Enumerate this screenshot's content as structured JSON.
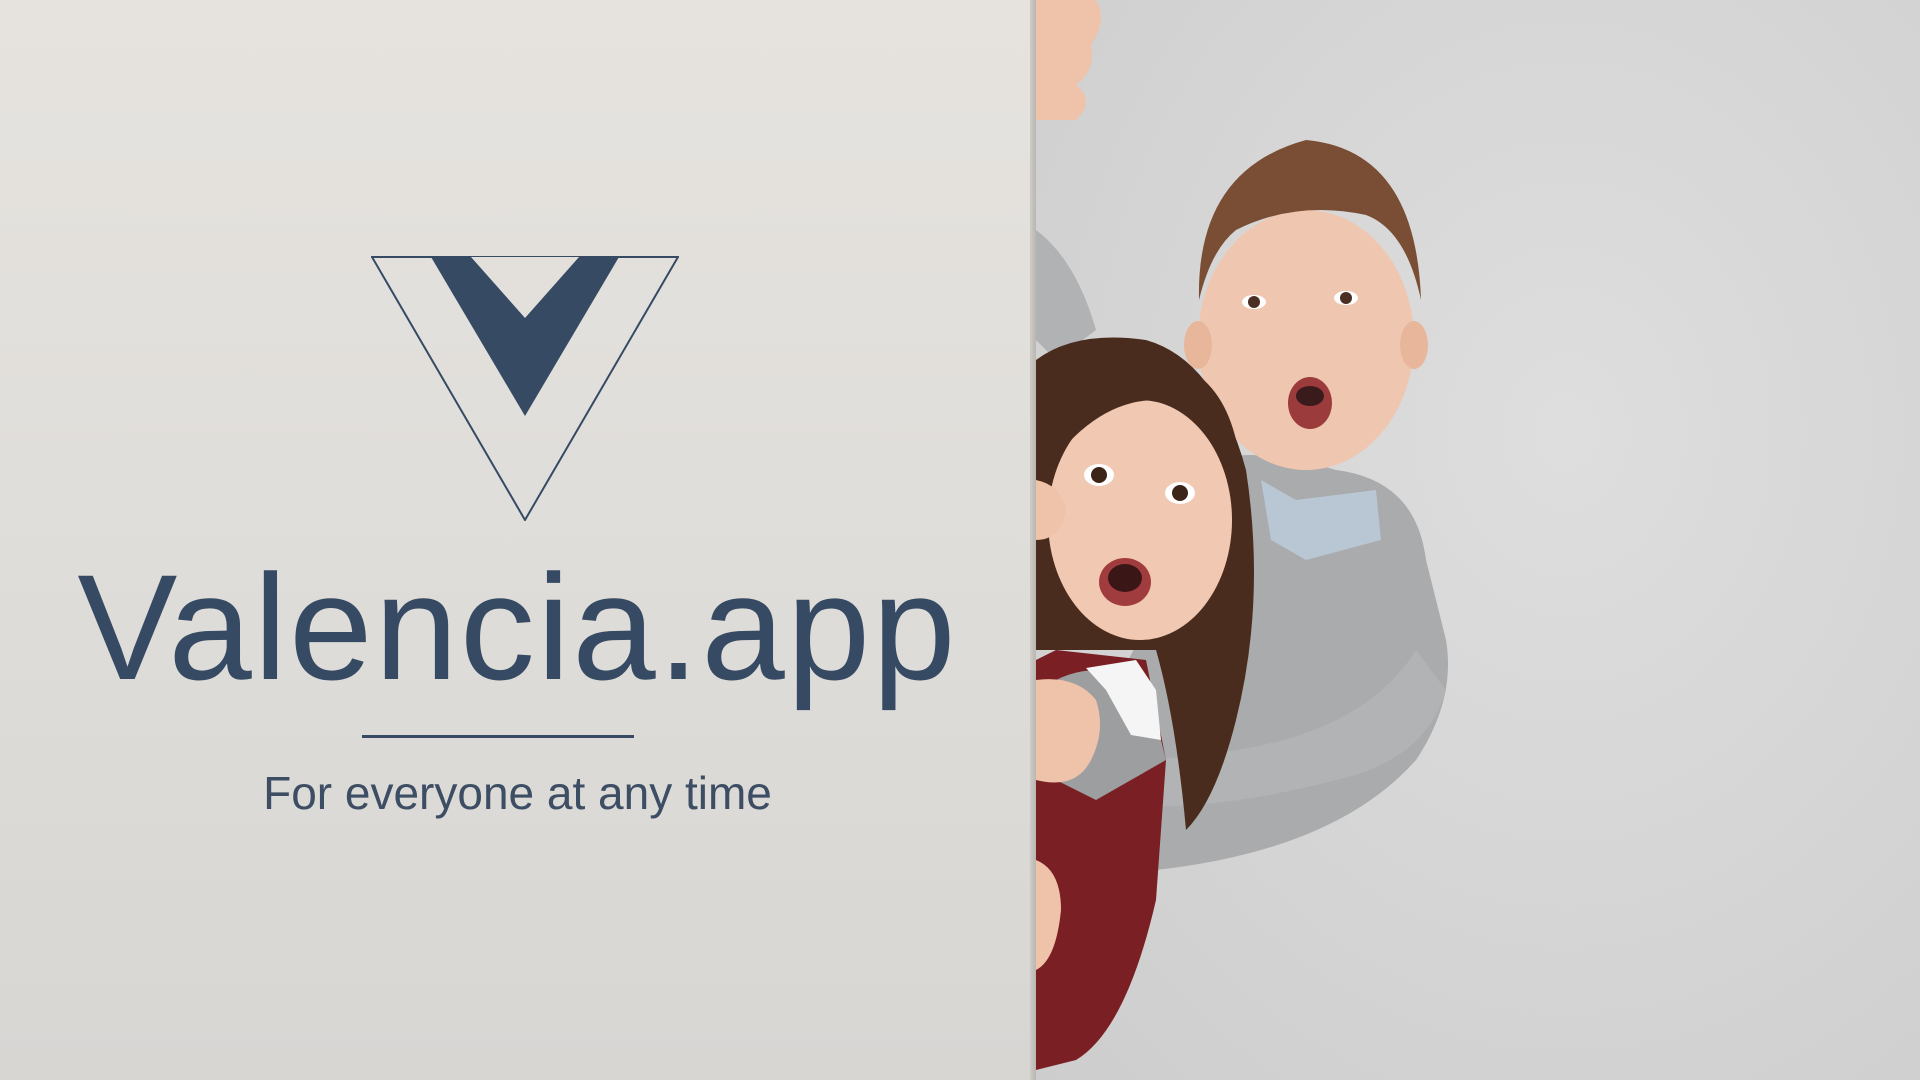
{
  "brand": {
    "name": "Valencia.app",
    "tagline": "For everyone at any time",
    "logo_icon": "v-triangle-logo-icon",
    "color": "#364a63"
  },
  "photo": {
    "subject": "two-children-peeking-photo"
  }
}
